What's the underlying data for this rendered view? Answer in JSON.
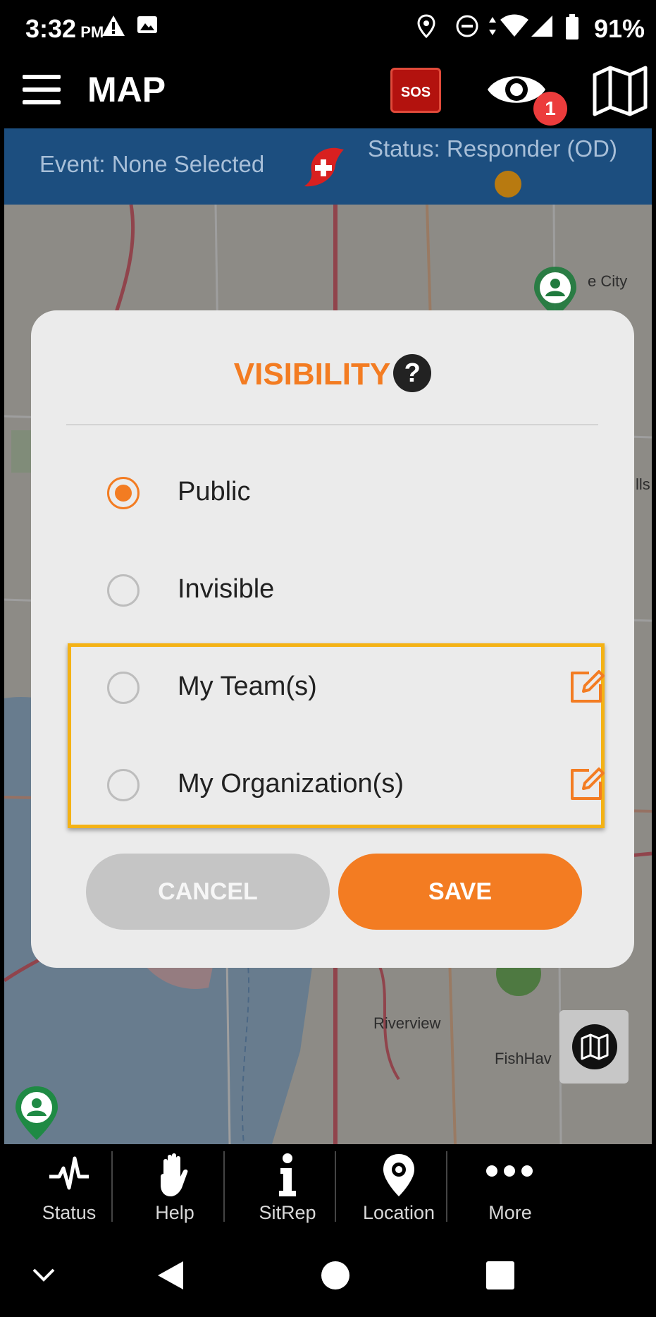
{
  "status_bar": {
    "time": "3:32",
    "ampm": "PM",
    "battery": "91%"
  },
  "app_bar": {
    "title": "MAP",
    "sos_label": "SOS",
    "notification_count": "1"
  },
  "event_bar": {
    "event_text": "Event: None Selected",
    "status_text": "Status: Responder (OD)",
    "status_color": "#b87a10"
  },
  "map": {
    "labels": [
      "e City",
      "lls",
      "Riverview",
      "FishHav"
    ]
  },
  "dialog": {
    "title": "VISIBILITY",
    "help_glyph": "?",
    "options": [
      {
        "label": "Public",
        "selected": true
      },
      {
        "label": "Invisible",
        "selected": false
      },
      {
        "label": "My Team(s)",
        "selected": false,
        "editable": true
      },
      {
        "label": "My Organization(s)",
        "selected": false,
        "editable": true
      }
    ],
    "cancel_label": "CANCEL",
    "save_label": "SAVE",
    "accent_color": "#f37c22",
    "highlight_color": "#f4b215"
  },
  "bottom_nav": {
    "items": [
      {
        "label": "Status",
        "icon": "heartbeat-icon"
      },
      {
        "label": "Help",
        "icon": "hand-icon"
      },
      {
        "label": "SitRep",
        "icon": "info-icon"
      },
      {
        "label": "Location",
        "icon": "location-pin-icon"
      },
      {
        "label": "More",
        "icon": "more-dots-icon"
      }
    ]
  }
}
